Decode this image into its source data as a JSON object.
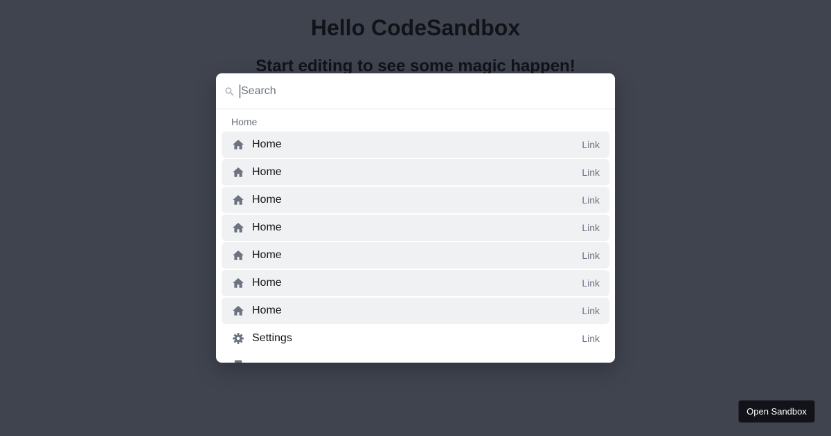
{
  "background": {
    "title": "Hello CodeSandbox",
    "subtitle": "Start editing to see some magic happen!"
  },
  "palette": {
    "search": {
      "placeholder": "Search",
      "icon": "search-icon"
    },
    "group_heading": "Home",
    "items": [
      {
        "label": "Home",
        "shortcut": "Link",
        "icon": "home-icon",
        "highlighted": true
      },
      {
        "label": "Home",
        "shortcut": "Link",
        "icon": "home-icon",
        "highlighted": true
      },
      {
        "label": "Home",
        "shortcut": "Link",
        "icon": "home-icon",
        "highlighted": true
      },
      {
        "label": "Home",
        "shortcut": "Link",
        "icon": "home-icon",
        "highlighted": true
      },
      {
        "label": "Home",
        "shortcut": "Link",
        "icon": "home-icon",
        "highlighted": true
      },
      {
        "label": "Home",
        "shortcut": "Link",
        "icon": "home-icon",
        "highlighted": true
      },
      {
        "label": "Home",
        "shortcut": "Link",
        "icon": "home-icon",
        "highlighted": true
      },
      {
        "label": "Settings",
        "shortcut": "Link",
        "icon": "gear-icon",
        "highlighted": false
      }
    ]
  },
  "open_sandbox_label": "Open Sandbox",
  "colors": {
    "overlay": "#40444f",
    "highlight": "#f0f1f3",
    "icon": "#6b7280",
    "button": "#111318"
  }
}
